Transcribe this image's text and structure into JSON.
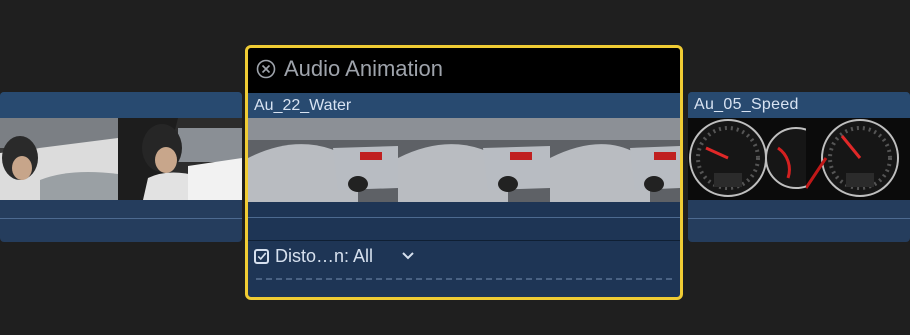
{
  "timeline": {
    "left_clip": {
      "thumb_icon": "race-driver-helmet-thumb"
    },
    "center_clip": {
      "name": "Au_22_Water",
      "thumb_icon": "car-water-splash-thumb"
    },
    "right_clip": {
      "name": "Au_05_Speed",
      "thumb_icon": "speedometer-thumb"
    },
    "audio_animation": {
      "title": "Audio Animation",
      "close_icon": "close-circle-icon",
      "effect_label": "Disto…n: All",
      "effect_checked": true,
      "dropdown_icon": "chevron-down-icon"
    },
    "colors": {
      "selection_border": "#f0cc34",
      "clip_fill": "#253d5d",
      "clip_bar": "#284a70",
      "background": "#1f1f1f"
    }
  }
}
